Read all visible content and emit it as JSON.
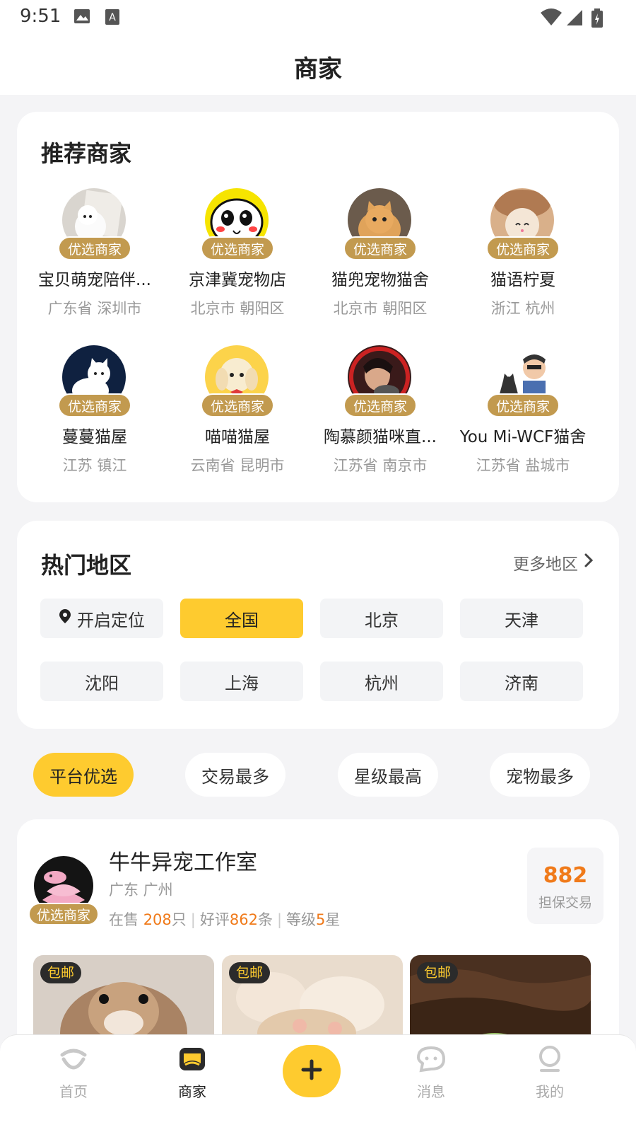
{
  "status_bar": {
    "time": "9:51"
  },
  "header": {
    "title": "商家"
  },
  "recommended": {
    "title": "推荐商家",
    "badge": "优选商家",
    "merchants": [
      {
        "name": "宝贝萌宠陪伴...",
        "location": "广东省 深圳市"
      },
      {
        "name": "京津冀宠物店",
        "location": "北京市 朝阳区"
      },
      {
        "name": "猫兜宠物猫舍",
        "location": "北京市 朝阳区"
      },
      {
        "name": "猫语柠夏",
        "location": "浙江 杭州"
      },
      {
        "name": "蔓蔓猫屋",
        "location": "江苏 镇江"
      },
      {
        "name": "喵喵猫屋",
        "location": "云南省 昆明市"
      },
      {
        "name": "陶慕颜猫咪直...",
        "location": "江苏省 南京市"
      },
      {
        "name": "You Mi-WCF猫舍",
        "location": "江苏省 盐城市"
      }
    ]
  },
  "areas": {
    "title": "热门地区",
    "more_label": "更多地区",
    "locate_label": "开启定位",
    "cities": [
      "全国",
      "北京",
      "天津",
      "沈阳",
      "上海",
      "杭州",
      "济南"
    ],
    "selected": "全国"
  },
  "sort_tabs": [
    "平台优选",
    "交易最多",
    "星级最高",
    "宠物最多"
  ],
  "shop": {
    "name": "牛牛异宠工作室",
    "location": "广东 广州",
    "badge": "优选商家",
    "on_sale_prefix": "在售 ",
    "on_sale": "208",
    "on_sale_suffix": "只",
    "reviews_prefix": "好评",
    "reviews": "862",
    "reviews_suffix": "条",
    "level_prefix": "等级",
    "level": "5",
    "level_suffix": "星",
    "guarantee_count": "882",
    "guarantee_label": "担保交易",
    "thumb_tag": "包邮"
  },
  "tabbar": {
    "items": [
      {
        "label": "首页",
        "icon": "home-icon"
      },
      {
        "label": "商家",
        "icon": "shop-icon"
      },
      {
        "label": "",
        "icon": "add-icon"
      },
      {
        "label": "消息",
        "icon": "message-icon"
      },
      {
        "label": "我的",
        "icon": "profile-icon"
      }
    ],
    "active": "商家"
  },
  "colors": {
    "accent": "#fecb2f",
    "badge": "#c29a4f",
    "highlight": "#f07a1a"
  }
}
